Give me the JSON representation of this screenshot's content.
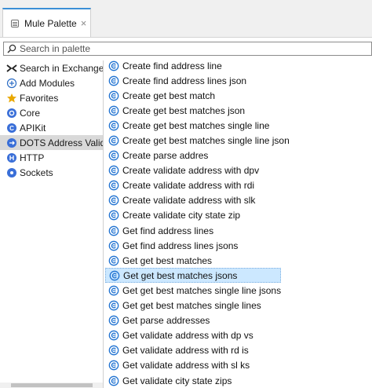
{
  "tab": {
    "title": "Mule Palette",
    "close": "×"
  },
  "search": {
    "placeholder": "Search in palette",
    "value": ""
  },
  "left_items": [
    {
      "label": "Search in Exchange...",
      "icon": "exchange-icon"
    },
    {
      "label": "Add Modules",
      "icon": "add-circle-icon"
    },
    {
      "label": "Favorites",
      "icon": "star-icon"
    },
    {
      "label": "Core",
      "icon": "core-icon"
    },
    {
      "label": "APIKit",
      "icon": "apikit-icon"
    },
    {
      "label": "DOTS Address Validat",
      "icon": "connector-icon",
      "selected": true
    },
    {
      "label": "HTTP",
      "icon": "http-icon"
    },
    {
      "label": "Sockets",
      "icon": "sockets-icon"
    }
  ],
  "operations": [
    "Create find address line",
    "Create find address lines json",
    "Create get best match",
    "Create get best matches json",
    "Create get best matches single line",
    "Create get best matches single line json",
    "Create parse addres",
    "Create validate address with dpv",
    "Create validate address with rdi",
    "Create validate address with slk",
    "Create validate city state zip",
    "Get find address lines",
    "Get find address lines jsons",
    "Get get best matches",
    "Get get best matches jsons",
    "Get get best matches single line jsons",
    "Get get best matches single lines",
    "Get parse addresses",
    "Get validate address with dp vs",
    "Get validate address with rd is",
    "Get validate address with sl ks",
    "Get validate city state zips"
  ],
  "selected_operation_index": 14,
  "colors": {
    "accent": "#3b8fd6",
    "selection": "#cce8ff",
    "left_selection": "#d9d9d9",
    "connector_icon": "#1f72d1",
    "star": "#e9a800"
  }
}
